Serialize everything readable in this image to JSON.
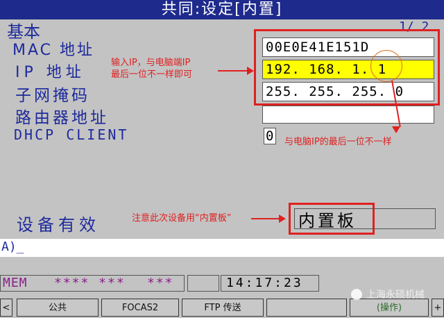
{
  "title": "共同:设定[内置]",
  "section": "基本",
  "page_indicator": "1/ 2",
  "fields": {
    "mac_label": "MAC 地址",
    "mac_value": "00E0E41E151D",
    "ip_label": "IP 地址",
    "ip_value": "192. 168. 1. 1",
    "subnet_label": "子网掩码",
    "subnet_value": "255. 255. 255. 0",
    "router_label": "路由器地址",
    "router_value": "",
    "dhcp_label": "DHCP CLIENT",
    "dhcp_value": "0",
    "device_label": "设备有效",
    "device_value": "内置板"
  },
  "annotations": {
    "ip_note_line1": "输入IP，与电脑端IP",
    "ip_note_line2": "最后一位不一样即可",
    "subnet_note": "与电脑IP的最后一位不一样",
    "device_note": "注意此次设备用“内置板”"
  },
  "command_line": "A)_",
  "status": {
    "mode": "MEM",
    "stars1": "**** ***",
    "stars2": "***",
    "time": "14:17:23"
  },
  "softkeys": {
    "left_arrow": "<",
    "k1": "公共",
    "k2": "FOCAS2",
    "k3": "FTP 传送",
    "k4": "",
    "k5": "(操作)",
    "right_arrow": "+"
  },
  "watermark": "上海永硕机械",
  "colors": {
    "title_bg": "#1e2a8c",
    "label": "#1e2a9c",
    "highlight": "#ffff00",
    "annotation": "#e02020"
  }
}
